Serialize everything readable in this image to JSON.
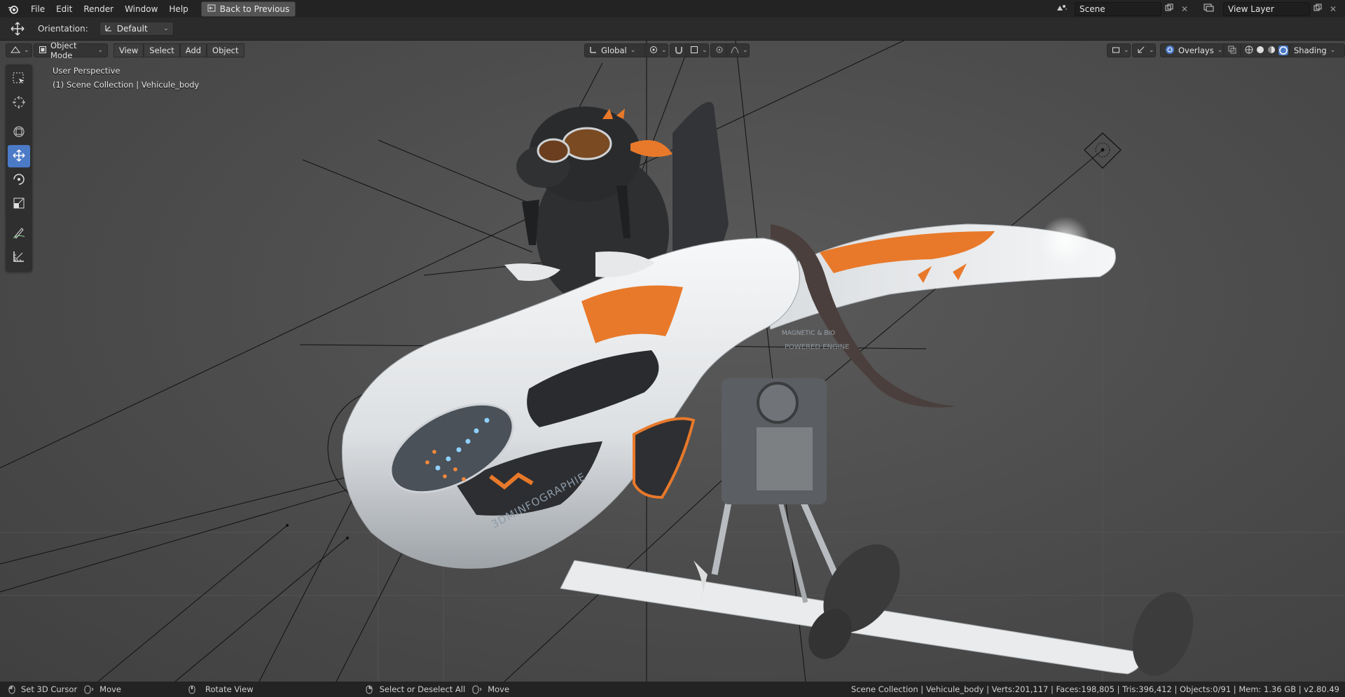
{
  "topbar": {
    "menus": [
      "File",
      "Edit",
      "Render",
      "Window",
      "Help"
    ],
    "back_button": "Back to Previous",
    "scene_name": "Scene",
    "view_layer": "View Layer"
  },
  "tool_options": {
    "orientation_label": "Orientation:",
    "orientation_value": "Default"
  },
  "viewport_header": {
    "mode": "Object Mode",
    "menus": [
      "View",
      "Select",
      "Add",
      "Object"
    ],
    "transform_orientation": "Global",
    "overlays": "Overlays",
    "shading": "Shading"
  },
  "viewport_info": {
    "perspective": "User Perspective",
    "collection": "(1) Scene Collection | Vehicule_body"
  },
  "model_text": {
    "brand": "3DMINFOGRAPHIE",
    "engine_line1": "MAGNETIC & BIO",
    "engine_line2": "POWERED ENGINE"
  },
  "statusbar": {
    "hint1": "Set 3D Cursor",
    "hint2": "Move",
    "hint3": "Rotate View",
    "hint4": "Select or Deselect All",
    "hint5": "Move",
    "stats": "Scene Collection | Vehicule_body | Verts:201,117 | Faces:198,805 | Tris:396,412 | Objects:0/91 | Mem: 1.36 GB | v2.80.49"
  },
  "colors": {
    "accent_blue": "#4b7ac7",
    "vehicle_orange": "#e8792a",
    "vehicle_white": "#eef0f2"
  },
  "icons": {
    "tools": [
      "select-box-icon",
      "cursor-icon",
      "transform-icon",
      "move-icon",
      "rotate-icon",
      "scale-icon",
      "annotate-icon",
      "measure-icon"
    ]
  }
}
